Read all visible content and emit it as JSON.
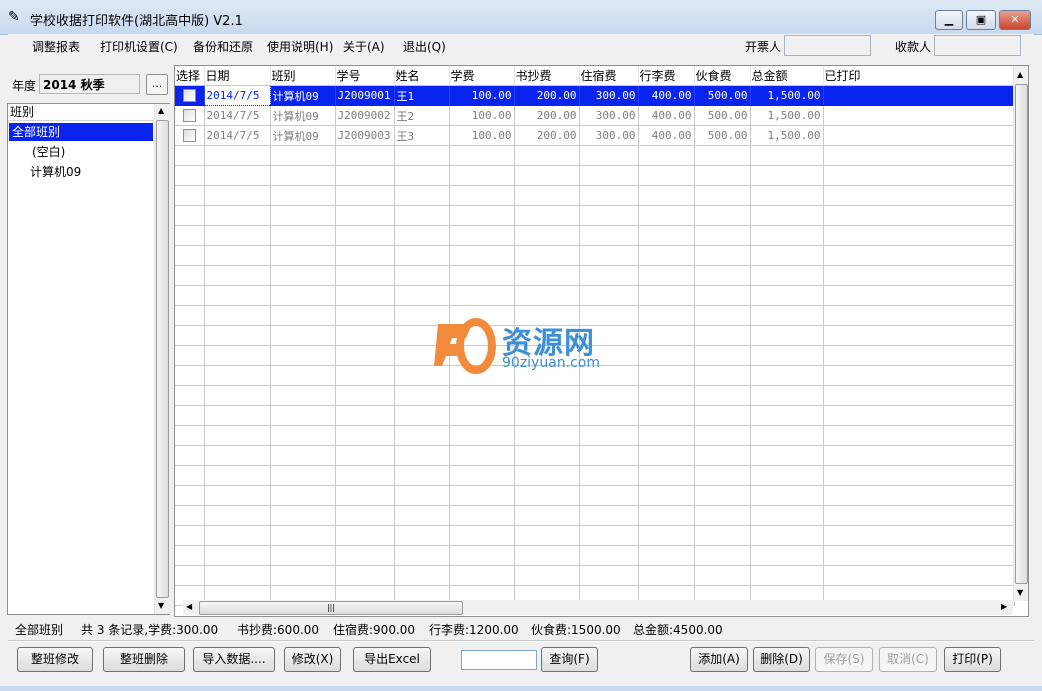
{
  "window": {
    "title": "学校收据打印软件(湖北高中版) V2.1"
  },
  "menu": [
    "调整报表",
    "打印机设置(C)",
    "备份和还原",
    "使用说明(H)",
    "关于(A)",
    "退出(Q)"
  ],
  "header_fields": {
    "issuer_label": "开票人",
    "issuer_value": "",
    "payee_label": "收款人",
    "payee_value": ""
  },
  "left": {
    "year_label": "年度",
    "year_value": "2014 秋季",
    "year_button": "...",
    "tree_header": "班别",
    "tree_items": [
      "全部班别",
      "(空白)",
      "计算机09"
    ]
  },
  "grid": {
    "columns": [
      "选择",
      "日期",
      "班别",
      "学号",
      "姓名",
      "学费",
      "书抄费",
      "住宿费",
      "行李费",
      "伙食费",
      "总金额",
      "已打印"
    ],
    "rows": [
      [
        "",
        "2014/7/5",
        "计算机09",
        "J2009001",
        "王1",
        "100.00",
        "200.00",
        "300.00",
        "400.00",
        "500.00",
        "1,500.00",
        ""
      ],
      [
        "",
        "2014/7/5",
        "计算机09",
        "J2009002",
        "王2",
        "100.00",
        "200.00",
        "300.00",
        "400.00",
        "500.00",
        "1,500.00",
        ""
      ],
      [
        "",
        "2014/7/5",
        "计算机09",
        "J2009003",
        "王3",
        "100.00",
        "200.00",
        "300.00",
        "400.00",
        "500.00",
        "1,500.00",
        ""
      ]
    ],
    "selected_row": 0
  },
  "watermark": {
    "text": "资源网",
    "url": "90ziyuan.com"
  },
  "status": {
    "class": "全部班别",
    "records": "共 3 条记录,学费:300.00",
    "book": "书抄费:600.00",
    "lodging": "住宿费:900.00",
    "luggage": "行李费:1200.00",
    "meals": "伙食费:1500.00",
    "total": "总金额:4500.00"
  },
  "buttons": {
    "class_edit": "整班修改",
    "class_delete": "整班删除",
    "import": "导入数据....",
    "modify": "修改(X)",
    "export": "导出Excel",
    "query": "查询(F)",
    "add": "添加(A)",
    "delete": "删除(D)",
    "save": "保存(S)",
    "cancel": "取消(C)",
    "print": "打印(P)"
  },
  "query_value": "",
  "colors": {
    "selection": "#0a24f0",
    "titlebar": "#c9d9ee",
    "watermark": "#3d8fd6",
    "watermark_logo": "#f28a3c"
  }
}
